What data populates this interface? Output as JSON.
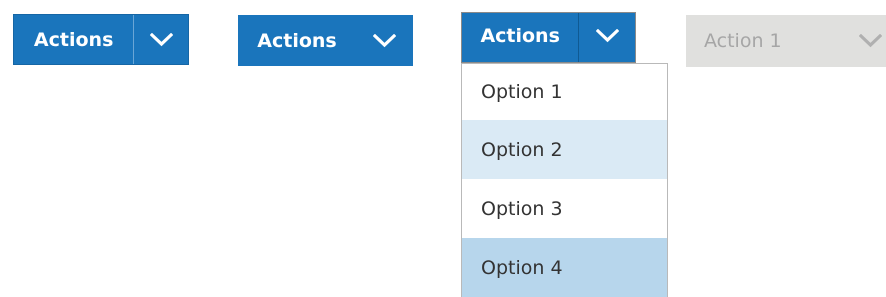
{
  "colors": {
    "primary": "#1a75bc",
    "disabled_bg": "#e0e0de",
    "disabled_text": "#a6a6a6",
    "option_hover": "#daeaf5",
    "option_selected": "#b7d6ec"
  },
  "split_button": {
    "label": "Actions",
    "caret_icon": "chevron-down-icon"
  },
  "combined_button": {
    "label": "Actions",
    "caret_icon": "chevron-down-icon"
  },
  "open_dropdown": {
    "label": "Actions",
    "caret_icon": "chevron-down-icon",
    "options": [
      {
        "label": "Option 1",
        "state": "normal"
      },
      {
        "label": "Option 2",
        "state": "hover"
      },
      {
        "label": "Option 3",
        "state": "normal"
      },
      {
        "label": "Option 4",
        "state": "selected"
      }
    ]
  },
  "disabled_dropdown": {
    "label": "Action 1",
    "caret_icon": "chevron-down-icon"
  }
}
